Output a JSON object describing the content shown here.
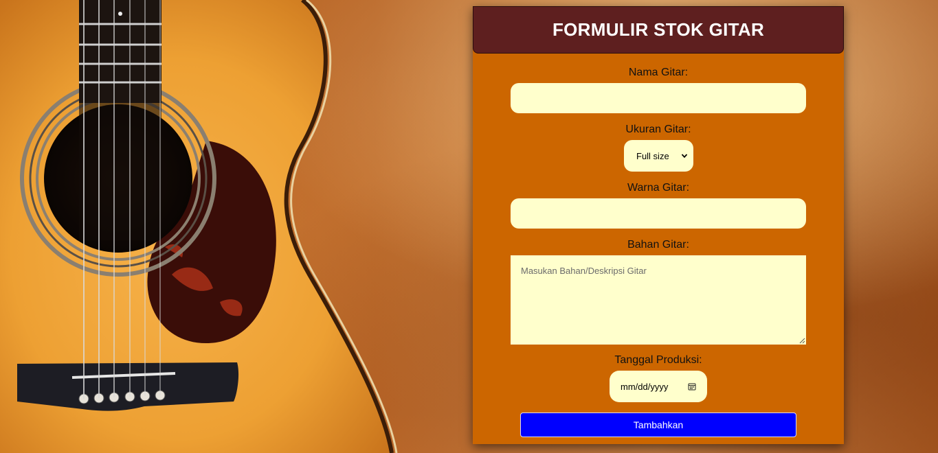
{
  "form": {
    "title": "FORMULIR STOK GITAR",
    "nama_label": "Nama Gitar:",
    "nama_value": "",
    "ukuran_label": "Ukuran Gitar:",
    "ukuran_selected": "Full size",
    "warna_label": "Warna Gitar:",
    "warna_value": "",
    "bahan_label": "Bahan Gitar:",
    "bahan_placeholder": "Masukan Bahan/Deskripsi Gitar",
    "tanggal_label": "Tanggal Produksi:",
    "tanggal_placeholder": "mm/dd/yyyy",
    "submit_label": "Tambahkan"
  },
  "icons": {
    "select": "chevron-down-icon",
    "date": "calendar-icon",
    "textarea": "resize-grip-icon"
  },
  "colors": {
    "panel": "#cc6600",
    "header": "#5e1f1f",
    "field": "#ffffcc",
    "button": "#0000ff"
  }
}
